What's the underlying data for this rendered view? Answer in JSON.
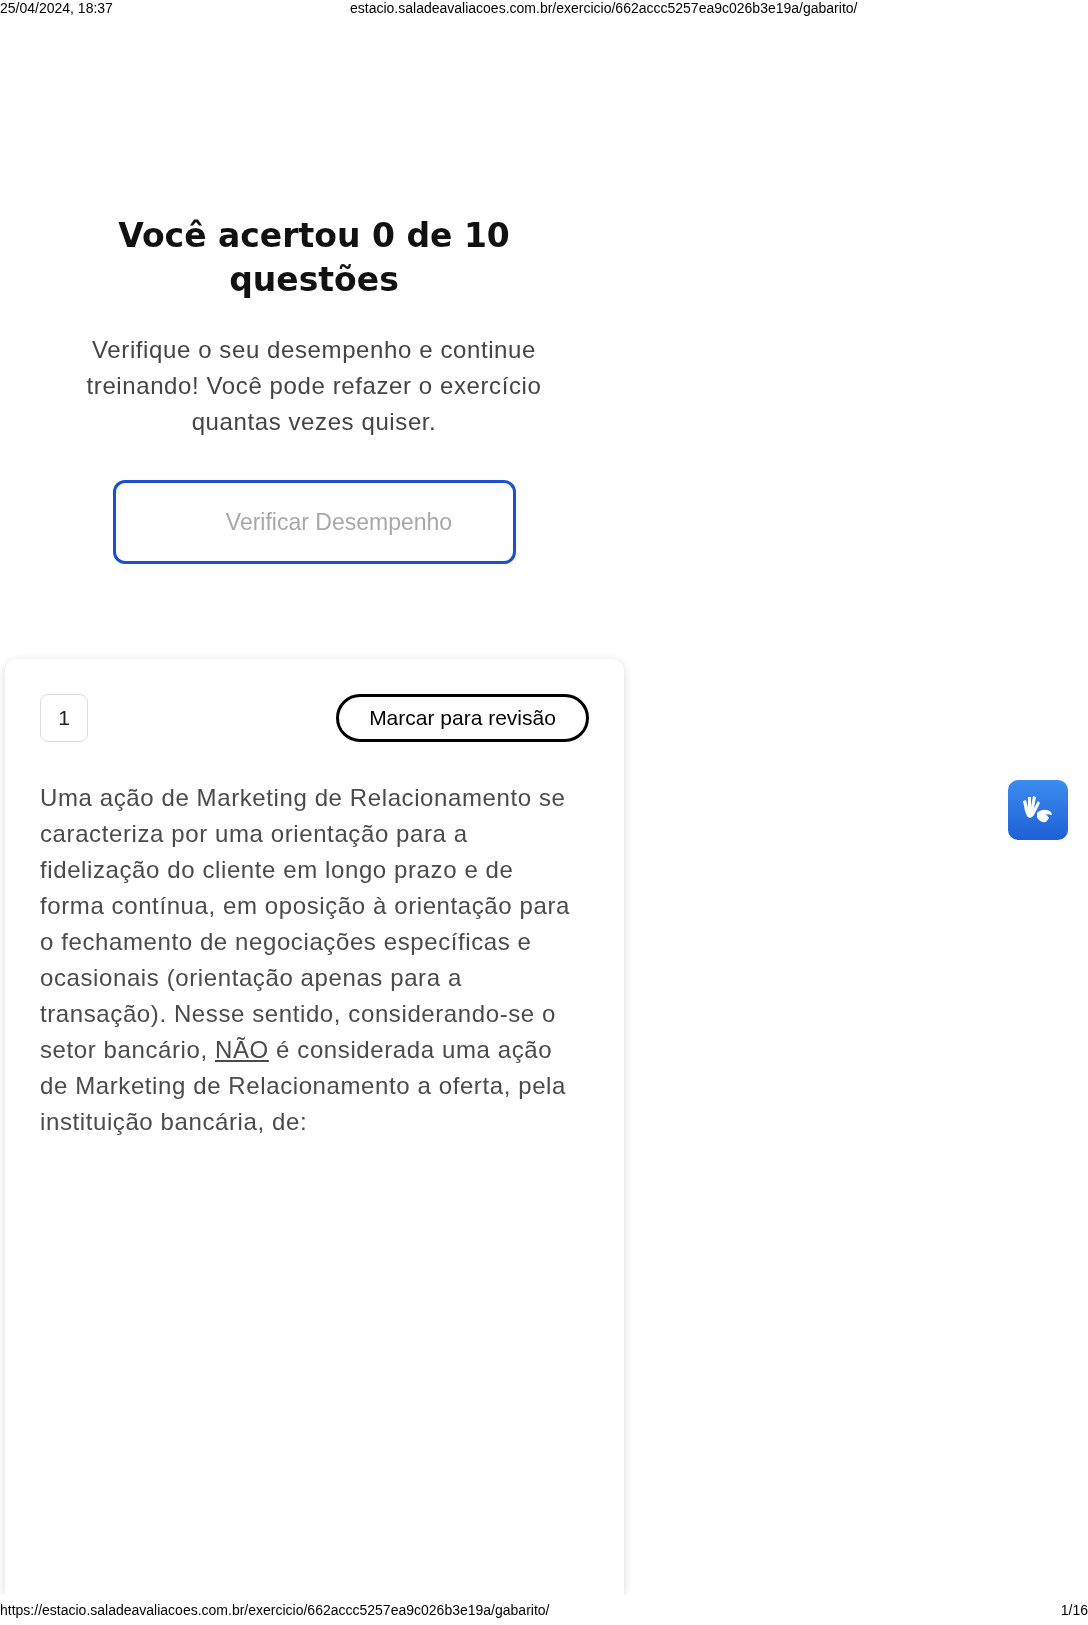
{
  "print_header": {
    "date": "25/04/2024, 18:37",
    "url": "estacio.saladeavaliacoes.com.br/exercicio/662accc5257ea9c026b3e19a/gabarito/"
  },
  "result": {
    "title": "Você acertou 0 de 10 questões",
    "message": "Verifique o seu desempenho e continue treinando! Você pode refazer o exercício quantas vezes quiser.",
    "button": "Verificar Desempenho"
  },
  "question": {
    "number": "1",
    "review_button": "Marcar para revisão",
    "text": [
      {
        "text": "Uma ação de Marketing de Relacionamento se caracteriza por uma orientação para a fidelização do cliente em longo prazo e de forma contínua, em oposição à orientação para o fechamento de negociações específicas e ocasionais (orientação apenas para a transação). Nesse sentido, considerando-se o setor bancário, ",
        "underline": false
      },
      {
        "text": "NÃO",
        "underline": true
      },
      {
        "text": " é considerada uma ação de Marketing de Relacionamento a oferta, pela instituição bancária, de:",
        "underline": false
      }
    ]
  },
  "print_footer": {
    "url": "https://estacio.saladeavaliacoes.com.br/exercicio/662accc5257ea9c026b3e19a/gabarito/",
    "page": "1/16"
  }
}
